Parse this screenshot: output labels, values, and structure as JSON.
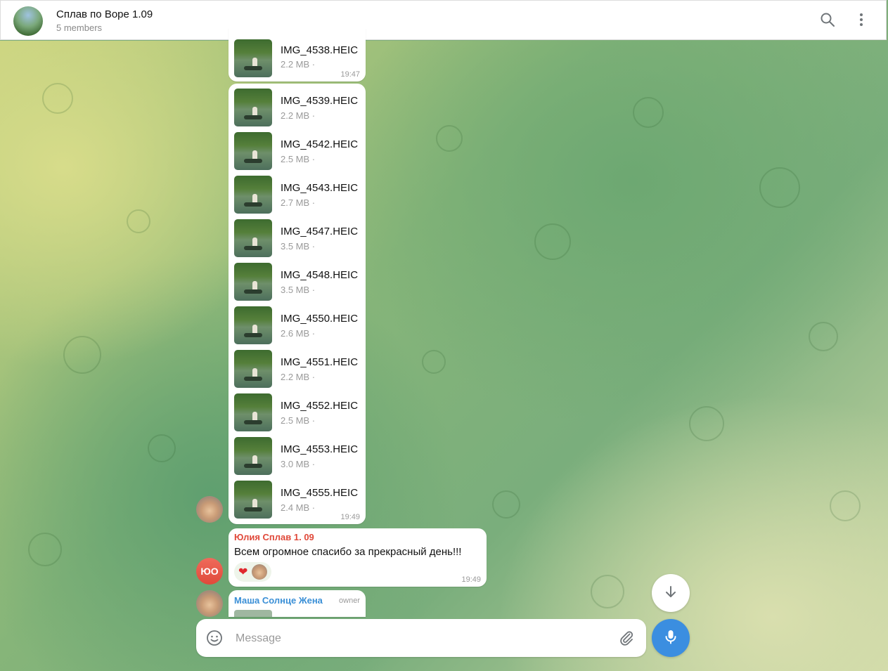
{
  "header": {
    "title": "Сплав по Воре 1.09",
    "subtitle": "5 members"
  },
  "files_top": {
    "name": "IMG_4538.HEIC",
    "size": "2.2 MB ·",
    "time": "19:47"
  },
  "files": [
    {
      "name": "IMG_4539.HEIC",
      "size": "2.2 MB ·"
    },
    {
      "name": "IMG_4542.HEIC",
      "size": "2.5 MB ·"
    },
    {
      "name": "IMG_4543.HEIC",
      "size": "2.7 MB ·"
    },
    {
      "name": "IMG_4547.HEIC",
      "size": "3.5 MB ·"
    },
    {
      "name": "IMG_4548.HEIC",
      "size": "3.5 MB ·"
    },
    {
      "name": "IMG_4550.HEIC",
      "size": "2.6 MB ·"
    },
    {
      "name": "IMG_4551.HEIC",
      "size": "2.2 MB ·"
    },
    {
      "name": "IMG_4552.HEIC",
      "size": "2.5 MB ·"
    },
    {
      "name": "IMG_4553.HEIC",
      "size": "3.0 MB ·"
    },
    {
      "name": "IMG_4555.HEIC",
      "size": "2.4 MB ·"
    }
  ],
  "files_time": "19:49",
  "message_yulia": {
    "sender": "Юлия Сплав 1. 09",
    "sender_color": "#e0493a",
    "avatar_initials": "ЮО",
    "text": "Всем огромное спасибо за прекрасный день!!!",
    "time": "19:49",
    "reaction": "❤️"
  },
  "message_masha": {
    "sender": "Маша Солнце Жена",
    "sender_color": "#3a8fd6",
    "badge": "owner"
  },
  "composer": {
    "placeholder": "Message"
  },
  "icons": {
    "search": "search-icon",
    "menu": "more-vertical-icon",
    "emoji": "smile-icon",
    "attach": "paperclip-icon",
    "mic": "microphone-icon",
    "scroll": "arrow-down-icon"
  },
  "colors": {
    "accent": "#3a8fd6",
    "mic_button": "#3b8ee0"
  }
}
